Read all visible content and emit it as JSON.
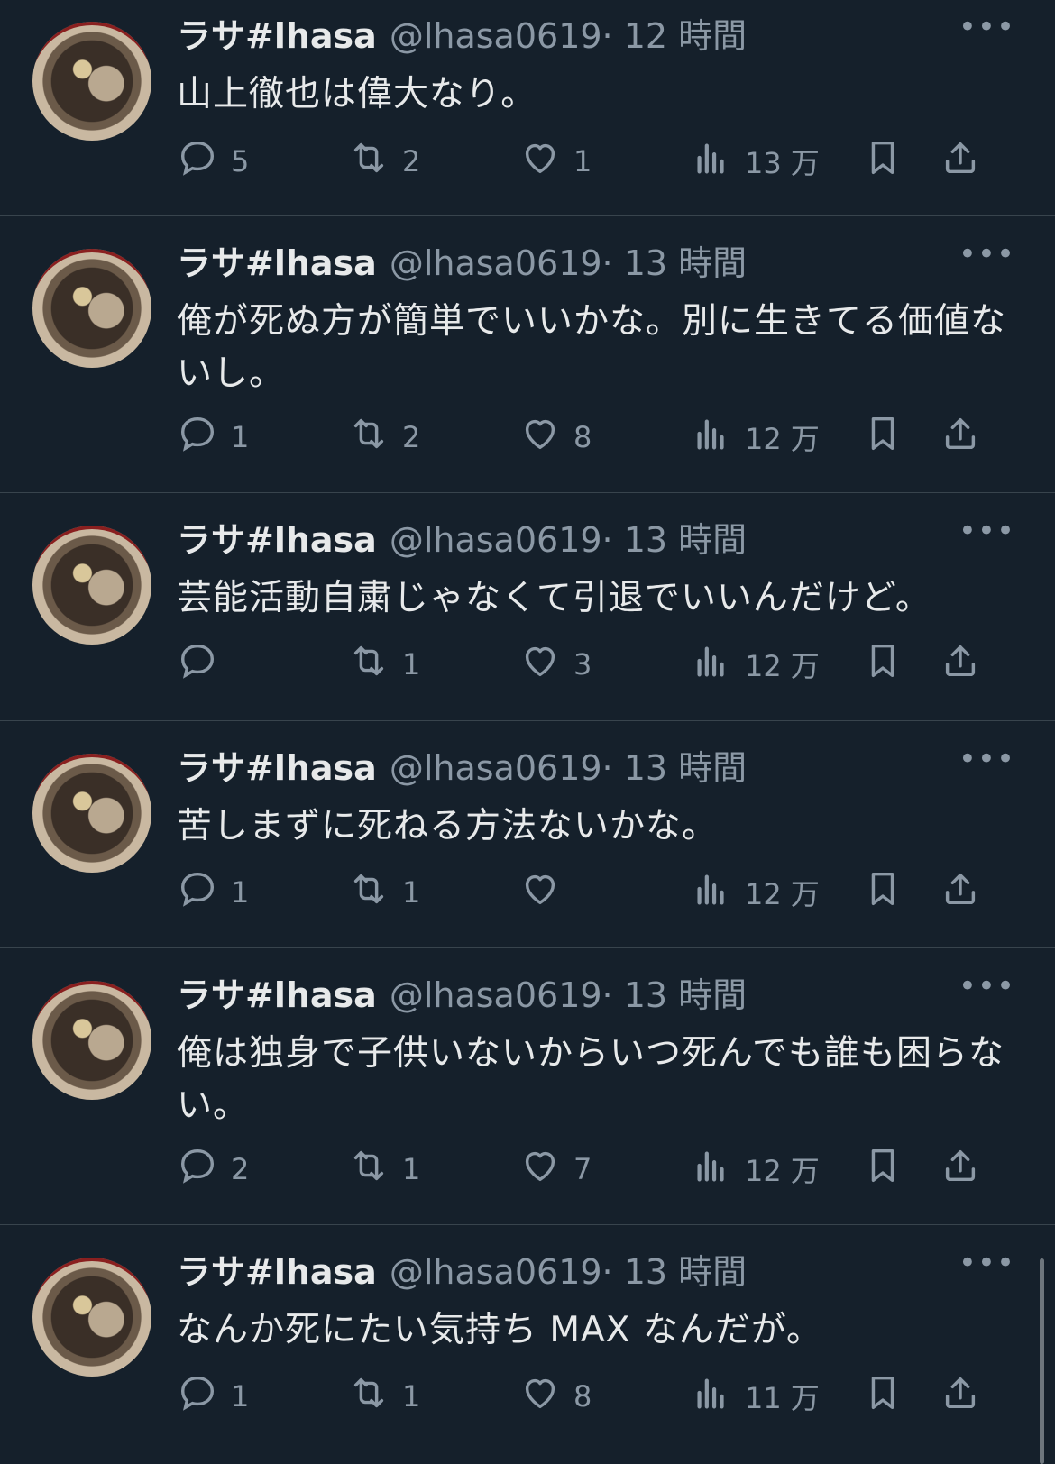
{
  "tweets": [
    {
      "name": "ラサ#lhasa",
      "handle": "@lhasa0619",
      "time": "· 12 時間",
      "text": "山上徹也は偉大なり。",
      "replies": "5",
      "retweets": "2",
      "likes": "1",
      "views": "13 万"
    },
    {
      "name": "ラサ#lhasa",
      "handle": "@lhasa0619",
      "time": "· 13 時間",
      "text": "俺が死ぬ方が簡単でいいかな。別に生きてる価値ないし。",
      "replies": "1",
      "retweets": "2",
      "likes": "8",
      "views": "12 万"
    },
    {
      "name": "ラサ#lhasa",
      "handle": "@lhasa0619",
      "time": "· 13 時間",
      "text": "芸能活動自粛じゃなくて引退でいいんだけど。",
      "replies": "",
      "retweets": "1",
      "likes": "3",
      "views": "12 万"
    },
    {
      "name": "ラサ#lhasa",
      "handle": "@lhasa0619",
      "time": "· 13 時間",
      "text": "苦しまずに死ねる方法ないかな。",
      "replies": "1",
      "retweets": "1",
      "likes": "",
      "views": "12 万"
    },
    {
      "name": "ラサ#lhasa",
      "handle": "@lhasa0619",
      "time": "· 13 時間",
      "text": "俺は独身で子供いないからいつ死んでも誰も困らない。",
      "replies": "2",
      "retweets": "1",
      "likes": "7",
      "views": "12 万"
    },
    {
      "name": "ラサ#lhasa",
      "handle": "@lhasa0619",
      "time": "· 13 時間",
      "text": "なんか死にたい気持ち MAX なんだが。",
      "replies": "1",
      "retweets": "1",
      "likes": "8",
      "views": "11 万"
    }
  ],
  "icons": {
    "more": "more-icon",
    "reply": "reply-icon",
    "retweet": "retweet-icon",
    "like": "heart-icon",
    "views": "views-icon",
    "bookmark": "bookmark-icon",
    "share": "share-icon"
  },
  "colors": {
    "background": "#15202b",
    "text": "#e7e9ea",
    "secondary": "#8b98a5",
    "divider": "#38444d"
  }
}
